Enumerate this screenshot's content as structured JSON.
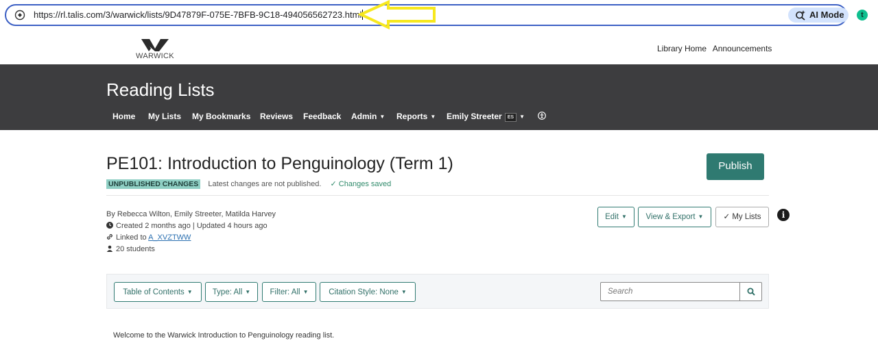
{
  "browser": {
    "url": "https://rl.talis.com/3/warwick/lists/9D47879F-075E-7BFB-9C18-494056562723.html",
    "ai_mode_label": "AI Mode",
    "extension_letter": "t"
  },
  "site": {
    "logo_text": "WARWICK",
    "top_links": [
      "Library Home",
      "Announcements"
    ]
  },
  "reading_lists": {
    "title": "Reading Lists",
    "nav": {
      "home": "Home",
      "my_lists": "My Lists",
      "my_bookmarks": "My Bookmarks",
      "reviews": "Reviews",
      "feedback": "Feedback",
      "admin": "Admin",
      "reports": "Reports",
      "user": "Emily Streeter",
      "user_initials": "ES"
    }
  },
  "list": {
    "title": "PE101: Introduction to Penguinology (Term 1)",
    "publish_label": "Publish",
    "badge": "UNPUBLISHED CHANGES",
    "status_text": "Latest changes are not published.",
    "saved_text": "Changes saved",
    "authors": "By Rebecca Wilton, Emily Streeter, Matilda Harvey",
    "created_updated": "Created 2 months ago | Updated 4 hours ago",
    "linked_prefix": "Linked to ",
    "linked_code": "A_XVZTWW",
    "students": "20 students",
    "actions": {
      "edit": "Edit",
      "view_export": "View & Export",
      "my_lists": "My Lists"
    }
  },
  "toolbar": {
    "toc": "Table of Contents",
    "type": "Type: All",
    "filter": "Filter: All",
    "citation": "Citation Style: None",
    "search_placeholder": "Search"
  },
  "welcome": "Welcome to the Warwick Introduction to Penguinology reading list.",
  "colors": {
    "accent": "#2f7a71",
    "band": "#3d3d3f",
    "badge": "#8fcfc4",
    "annotation_arrow": "#f7e81e"
  }
}
